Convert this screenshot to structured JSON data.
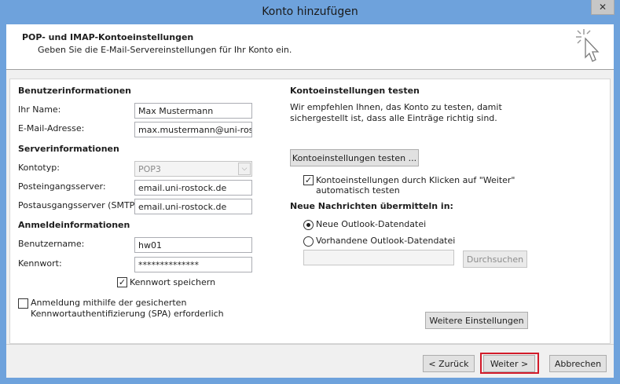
{
  "window": {
    "title": "Konto hinzufügen",
    "close_glyph": "✕"
  },
  "header": {
    "title": "POP- und IMAP-Kontoeinstellungen",
    "subtitle": "Geben Sie die E-Mail-Servereinstellungen für Ihr Konto ein."
  },
  "left": {
    "user_section": "Benutzerinformationen",
    "name_label": "Ihr Name:",
    "name_value": "Max Mustermann",
    "email_label": "E-Mail-Adresse:",
    "email_value": "max.mustermann@uni-rostc",
    "server_section": "Serverinformationen",
    "account_type_label": "Kontotyp:",
    "account_type_value": "POP3",
    "incoming_label": "Posteingangsserver:",
    "incoming_value": "email.uni-rostock.de",
    "outgoing_label": "Postausgangsserver (SMTP):",
    "outgoing_value": "email.uni-rostock.de",
    "login_section": "Anmeldeinformationen",
    "username_label": "Benutzername:",
    "username_value": "hw01",
    "password_label": "Kennwort:",
    "password_value": "**************",
    "remember_password_label": "Kennwort speichern",
    "remember_password_checked": true,
    "spa_label_line1": "Anmeldung mithilfe der gesicherten",
    "spa_label_line2": "Kennwortauthentifizierung (SPA) erforderlich",
    "spa_checked": false
  },
  "right": {
    "test_section": "Kontoeinstellungen testen",
    "test_desc_line1": "Wir empfehlen Ihnen, das Konto zu testen, damit",
    "test_desc_line2": "sichergestellt ist, dass alle Einträge richtig sind.",
    "test_button": "Kontoeinstellungen testen ...",
    "auto_test_line1": "Kontoeinstellungen durch Klicken auf \"Weiter\"",
    "auto_test_line2": "automatisch testen",
    "auto_test_checked": true,
    "deliver_section": "Neue Nachrichten übermitteln in:",
    "radio_new": "Neue Outlook-Datendatei",
    "radio_existing": "Vorhandene Outlook-Datendatei",
    "selected_option": "new",
    "browse_button": "Durchsuchen",
    "more_settings_button": "Weitere Einstellungen"
  },
  "footer": {
    "back_button": "< Zurück",
    "next_button": "Weiter >",
    "cancel_button": "Abbrechen"
  },
  "colors": {
    "titlebar": "#6ea2dc",
    "highlight": "#d21b2a"
  }
}
